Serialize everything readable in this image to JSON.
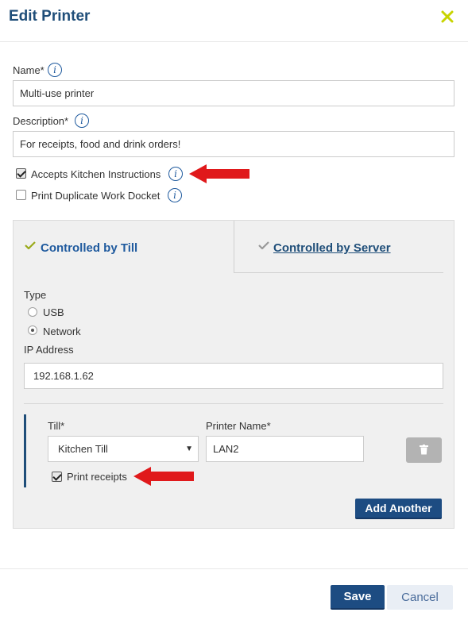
{
  "dialog": {
    "title": "Edit Printer",
    "close_icon": "close-x-icon",
    "accent_color": "#1f4e79",
    "close_color": "#c8d400"
  },
  "form": {
    "name": {
      "label": "Name*",
      "value": "Multi-use printer"
    },
    "description": {
      "label": "Description*",
      "value": "For receipts, food and drink orders!"
    },
    "accepts_kitchen_instructions": {
      "label": "Accepts Kitchen Instructions",
      "checked": true
    },
    "print_duplicate_work_docket": {
      "label": "Print Duplicate Work Docket",
      "checked": false
    }
  },
  "tabs": [
    {
      "label": "Controlled by Till",
      "active": true
    },
    {
      "label": "Controlled by Server",
      "active": false
    }
  ],
  "connection": {
    "type_label": "Type",
    "options": [
      {
        "label": "USB",
        "selected": false
      },
      {
        "label": "Network",
        "selected": true
      }
    ],
    "ip_label": "IP Address",
    "ip_value": "192.168.1.62"
  },
  "till_entry": {
    "till_label": "Till*",
    "till_value": "Kitchen Till",
    "printer_name_label": "Printer Name*",
    "printer_name_value": "LAN2",
    "print_receipts": {
      "label": "Print receipts",
      "checked": true
    },
    "delete_icon": "trash-icon"
  },
  "buttons": {
    "add_another": "Add Another",
    "save": "Save",
    "cancel": "Cancel"
  },
  "annotation_color": "#e0191b"
}
